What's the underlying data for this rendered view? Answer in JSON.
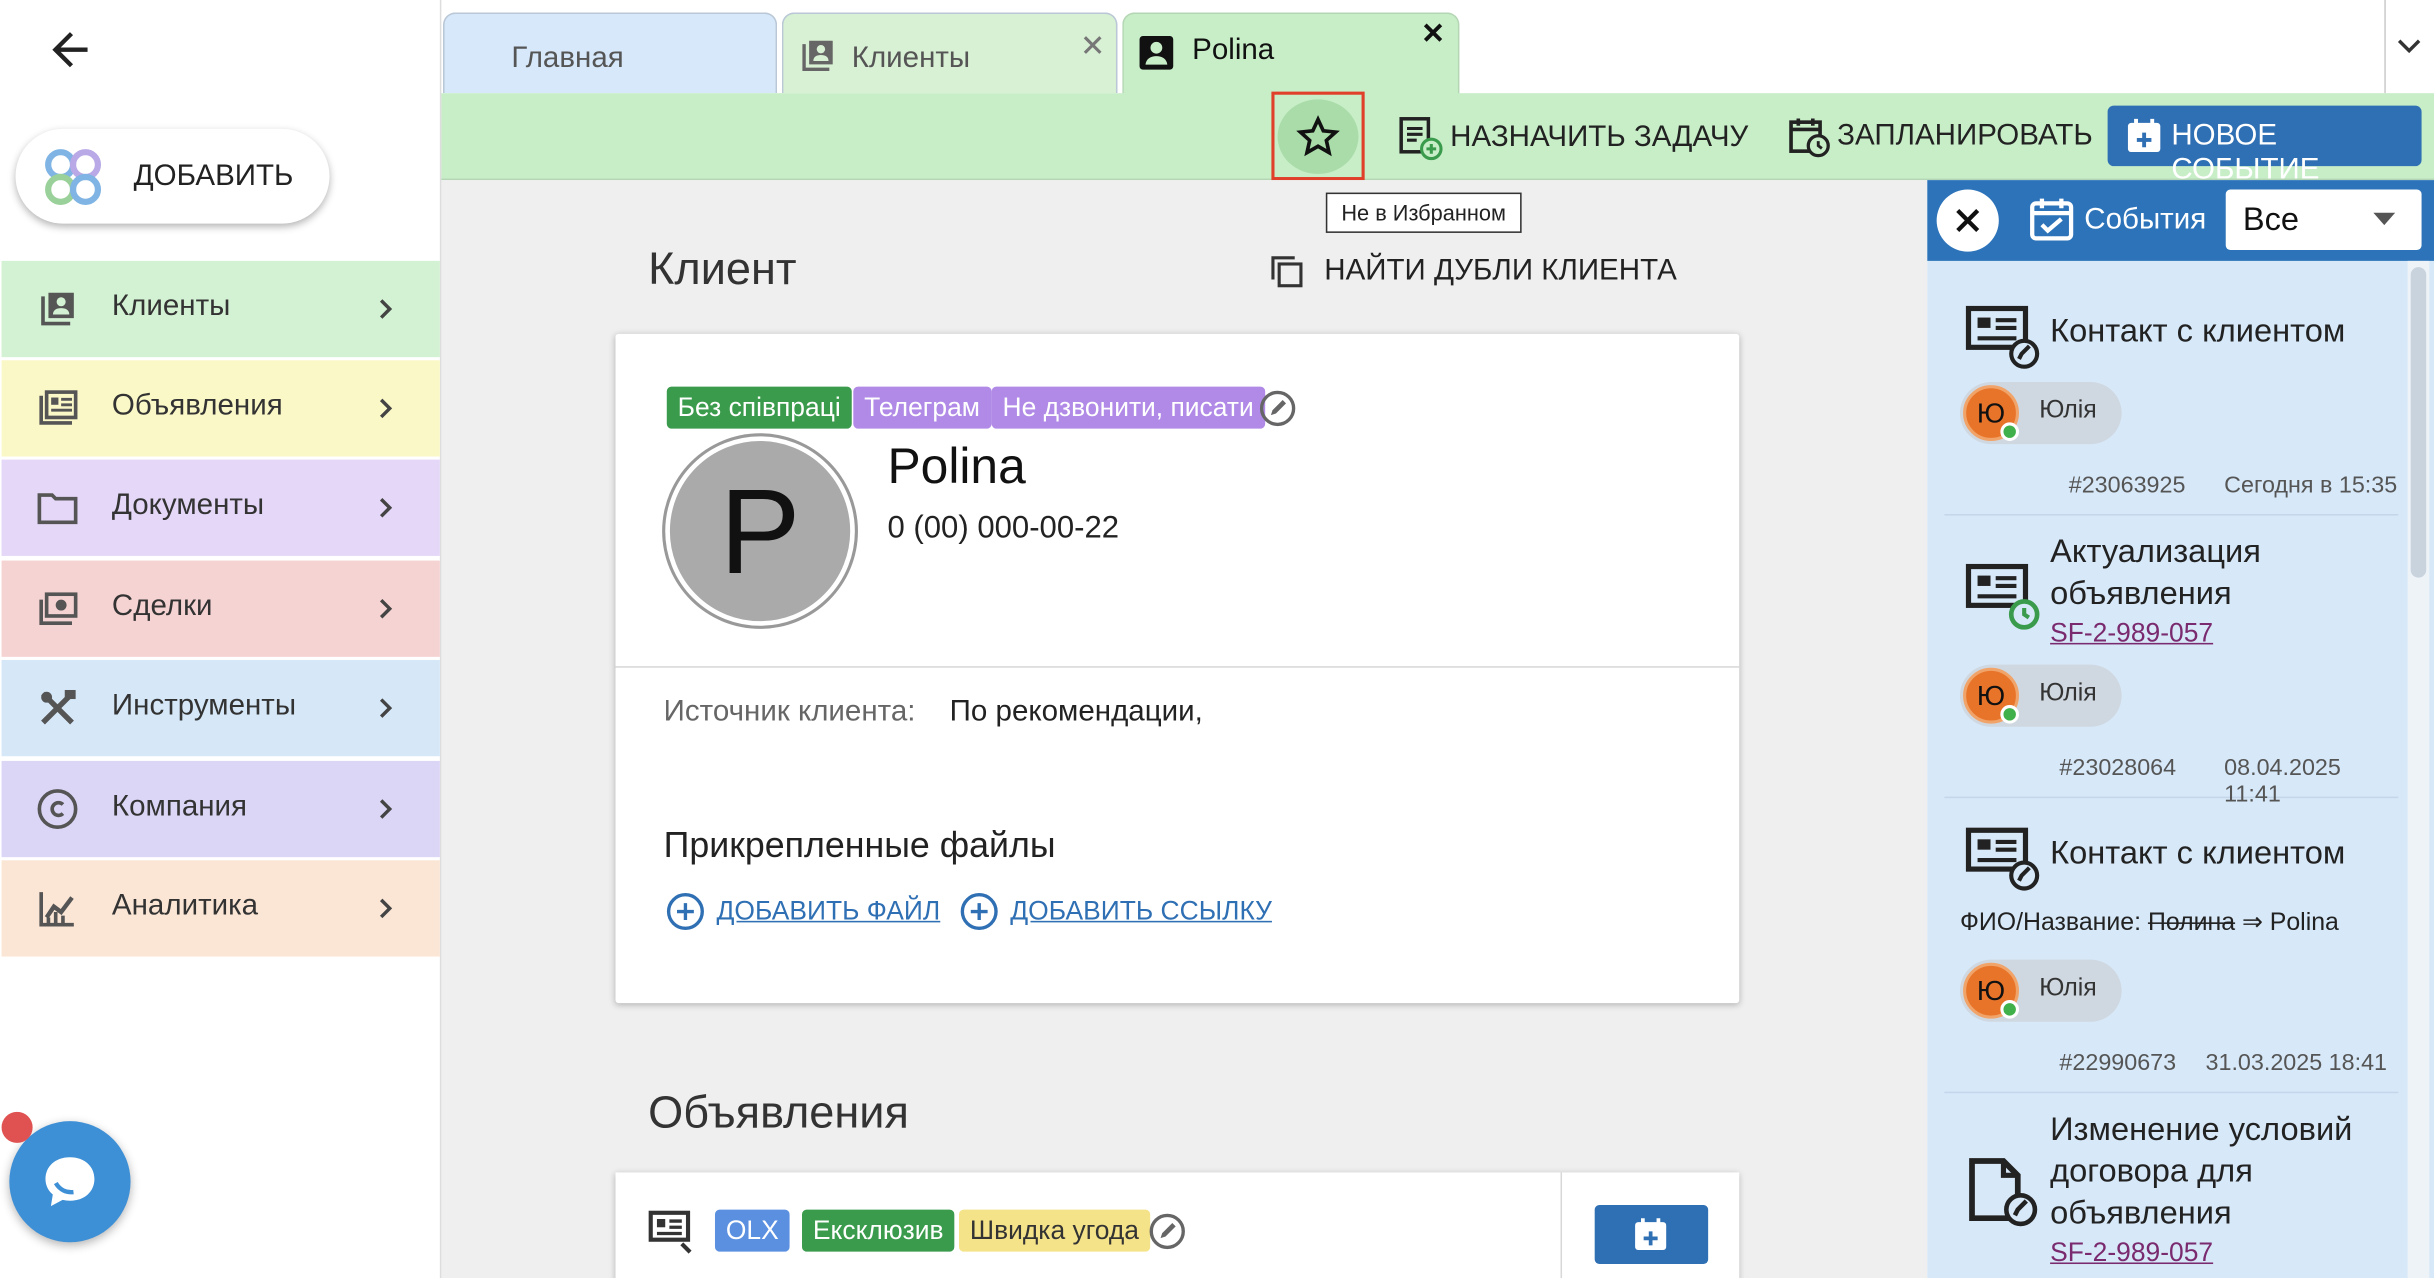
{
  "sidebar": {
    "add_label": "ДОБАВИТЬ",
    "items": [
      {
        "label": "Клиенты",
        "icon": "clients-icon",
        "color": "#d3f2d3"
      },
      {
        "label": "Объявления",
        "icon": "listings-icon",
        "color": "#fbf8c8"
      },
      {
        "label": "Документы",
        "icon": "folder-icon",
        "color": "#e4d7f7"
      },
      {
        "label": "Сделки",
        "icon": "money-icon",
        "color": "#f6d3d3"
      },
      {
        "label": "Инструменты",
        "icon": "tools-icon",
        "color": "#d6e8f8"
      },
      {
        "label": "Компания",
        "icon": "copyright-icon",
        "color": "#dcd6f6"
      },
      {
        "label": "Аналитика",
        "icon": "analytics-icon",
        "color": "#fbe6d6"
      }
    ]
  },
  "tabs": [
    {
      "label": "Главная",
      "active": false
    },
    {
      "label": "Клиенты",
      "active": false
    },
    {
      "label": "Polina",
      "active": true
    }
  ],
  "toolbar": {
    "assign_task": "НАЗНАЧИТЬ ЗАДАЧУ",
    "schedule": "ЗАПЛАНИРОВАТЬ",
    "new_event": "НОВОЕ СОБЫТИЕ",
    "tooltip": "Не в Избранном"
  },
  "client": {
    "heading": "Клиент",
    "find_duplicates": "НАЙТИ ДУБЛИ КЛИЕНТА",
    "tags": [
      {
        "label": "Без співпраці",
        "color": "#3b9b4c"
      },
      {
        "label": "Телеграм",
        "color": "#b08ae6"
      },
      {
        "label": "Не дзвонити, писати",
        "color": "#b08ae6"
      }
    ],
    "avatar_letter": "P",
    "name": "Polina",
    "phone": "0 (00) 000-00-22",
    "source_label": "Источник клиента:",
    "source_value": "По рекомендации,",
    "files_heading": "Прикрепленные файлы",
    "add_file": "ДОБАВИТЬ ФАЙЛ",
    "add_link": "ДОБАВИТЬ ССЫЛКУ"
  },
  "listings": {
    "heading": "Объявления",
    "tags": [
      {
        "label": "OLX",
        "color": "#5b8fe0"
      },
      {
        "label": "Ексклюзив",
        "color": "#3b9b4c"
      },
      {
        "label": "Швидка угода",
        "color": "#f5e38a"
      }
    ]
  },
  "events": {
    "title": "События",
    "filter_value": "Все",
    "items": [
      {
        "title": "Контакт с клиентом",
        "user_initial": "Ю",
        "user": "Юлія",
        "id": "#23063925",
        "time": "Сегодня в 15:35"
      },
      {
        "title_line1": "Актуализация",
        "title_line2": "объявления",
        "link": "SF-2-989-057",
        "user_initial": "Ю",
        "user": "Юлія",
        "id": "#23028064",
        "time": "08.04.2025 11:41"
      },
      {
        "title": "Контакт с клиентом",
        "change_label": "ФИО/Название:",
        "old_value": "Полина",
        "arrow": "⇒",
        "new_value": "Polina",
        "user_initial": "Ю",
        "user": "Юлія",
        "id": "#22990673",
        "time": "31.03.2025 18:41"
      },
      {
        "title_line1": "Изменение условий",
        "title_line2": "договора для",
        "title_line3": "объявления",
        "link": "SF-2-989-057"
      }
    ]
  }
}
